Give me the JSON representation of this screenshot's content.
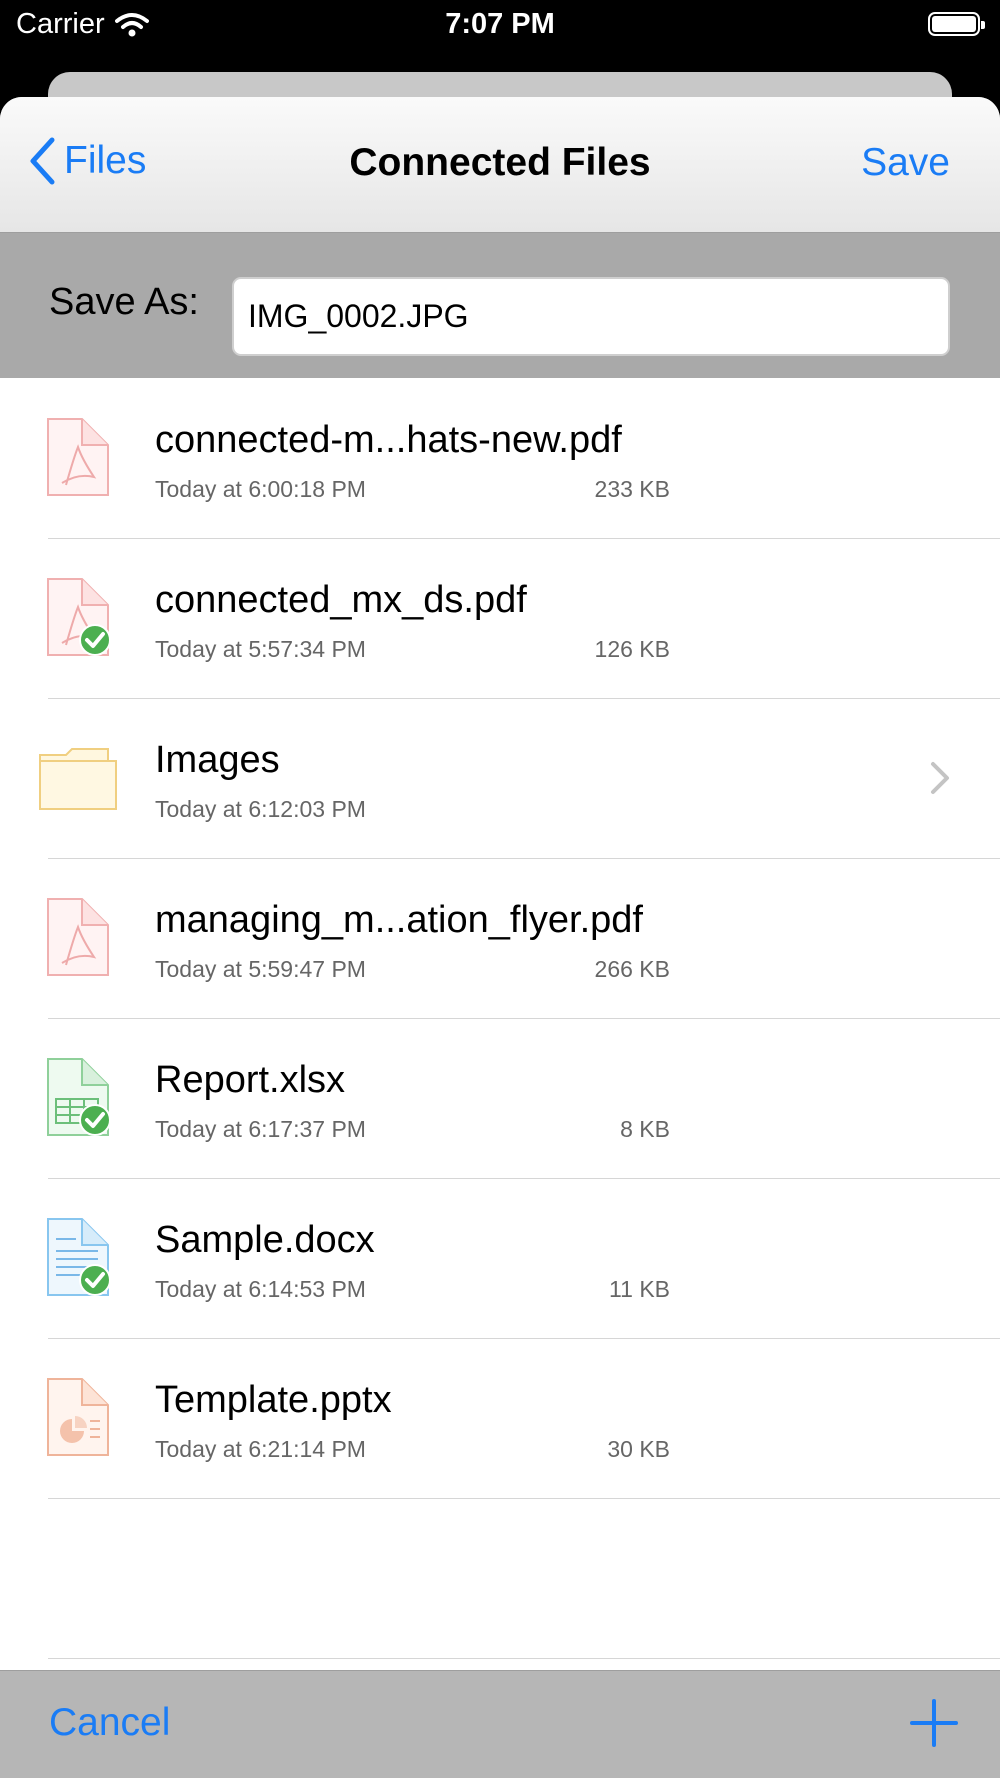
{
  "status_bar": {
    "carrier": "Carrier",
    "time": "7:07 PM"
  },
  "nav": {
    "back_label": "Files",
    "title": "Connected Files",
    "save_label": "Save"
  },
  "save_as": {
    "label": "Save As:",
    "value": "IMG_0002.JPG"
  },
  "files": [
    {
      "name": "connected-m...hats-new.pdf",
      "date": "Today at 6:00:18 PM",
      "size": "233 KB",
      "icon": "pdf-icon",
      "synced": false
    },
    {
      "name": "connected_mx_ds.pdf",
      "date": "Today at 5:57:34 PM",
      "size": "126 KB",
      "icon": "pdf-icon",
      "synced": true
    },
    {
      "name": "Images",
      "date": "Today at 6:12:03 PM",
      "size": "",
      "icon": "folder-icon",
      "synced": false
    },
    {
      "name": "managing_m...ation_flyer.pdf",
      "date": "Today at 5:59:47 PM",
      "size": "266 KB",
      "icon": "pdf-icon",
      "synced": false
    },
    {
      "name": "Report.xlsx",
      "date": "Today at 6:17:37 PM",
      "size": "8 KB",
      "icon": "spreadsheet-icon",
      "synced": true
    },
    {
      "name": "Sample.docx",
      "date": "Today at 6:14:53 PM",
      "size": "11 KB",
      "icon": "document-icon",
      "synced": true
    },
    {
      "name": "Template.pptx",
      "date": "Today at 6:21:14 PM",
      "size": "30 KB",
      "icon": "presentation-icon",
      "synced": false
    }
  ],
  "toolbar": {
    "cancel_label": "Cancel"
  },
  "colors": {
    "accent": "#1a7cf5",
    "sync_check": "#4caf50"
  }
}
